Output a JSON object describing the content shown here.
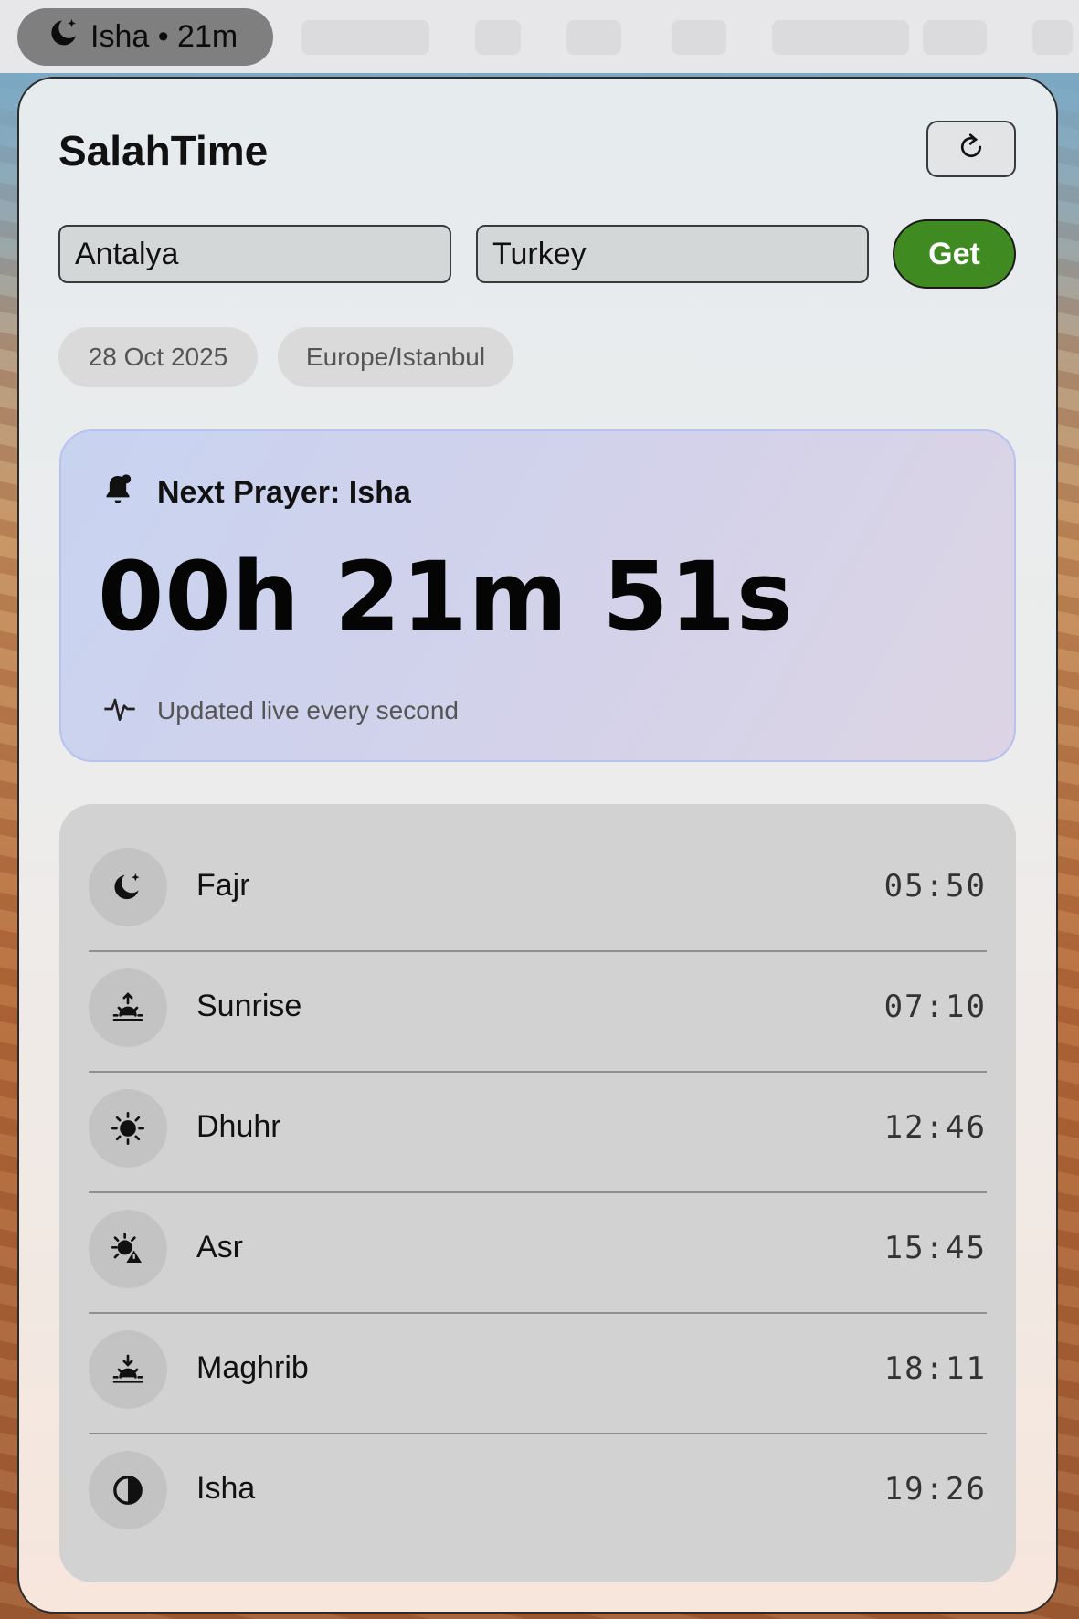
{
  "menubar": {
    "status_text": "Isha • 21m",
    "status_icon": "moon-stars-icon"
  },
  "app": {
    "title": "SalahTime",
    "refresh_icon": "refresh-icon"
  },
  "form": {
    "city_value": "Antalya",
    "country_value": "Turkey",
    "get_label": "Get"
  },
  "info": {
    "date": "28 Oct 2025",
    "timezone": "Europe/Istanbul"
  },
  "next_prayer": {
    "title": "Next Prayer: Isha",
    "countdown": "00h 21m 51s",
    "live_text": "Updated live every second"
  },
  "prayers": [
    {
      "name": "Fajr",
      "time": "05:50",
      "icon": "moon-stars-icon"
    },
    {
      "name": "Sunrise",
      "time": "07:10",
      "icon": "sunrise-icon"
    },
    {
      "name": "Dhuhr",
      "time": "12:46",
      "icon": "sun-icon"
    },
    {
      "name": "Asr",
      "time": "15:45",
      "icon": "sun-haze-icon"
    },
    {
      "name": "Maghrib",
      "time": "18:11",
      "icon": "sunset-icon"
    },
    {
      "name": "Isha",
      "time": "19:26",
      "icon": "half-circle-icon"
    }
  ],
  "colors": {
    "accent_green": "#3f8b22",
    "card_blue": "#c8d3f0"
  }
}
